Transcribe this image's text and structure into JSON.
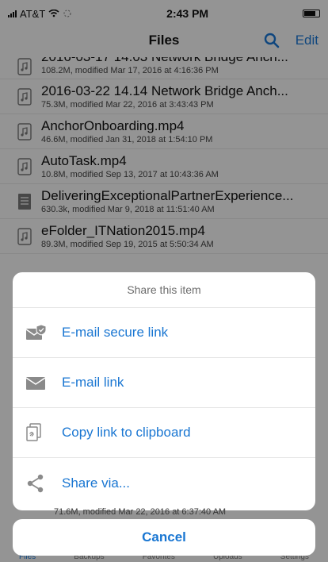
{
  "status_bar": {
    "carrier": "AT&T",
    "time": "2:43 PM"
  },
  "nav": {
    "title": "Files",
    "edit_label": "Edit",
    "search_icon": "search-icon"
  },
  "files": [
    {
      "name": "2016-03-17 14.03 Network Bridge Anch...",
      "meta": "108.2M, modified Mar 17, 2016 at 4:16:36 PM",
      "icon": "audio-file-icon"
    },
    {
      "name": "2016-03-22 14.14 Network Bridge Anch...",
      "meta": "75.3M, modified Mar 22, 2016 at 3:43:43 PM",
      "icon": "audio-file-icon"
    },
    {
      "name": "AnchorOnboarding.mp4",
      "meta": "46.6M, modified Jan 31, 2018 at 1:54:10 PM",
      "icon": "audio-file-icon"
    },
    {
      "name": "AutoTask.mp4",
      "meta": "10.8M, modified Sep 13, 2017 at 10:43:36 AM",
      "icon": "audio-file-icon"
    },
    {
      "name": "DeliveringExceptionalPartnerExperience...",
      "meta": "630.3k, modified Mar 9, 2018 at 11:51:40 AM",
      "icon": "document-icon"
    },
    {
      "name": "eFolder_ITNation2015.mp4",
      "meta": "89.3M, modified Sep 19, 2015 at 5:50:34 AM",
      "icon": "audio-file-icon"
    }
  ],
  "share_sheet": {
    "title": "Share this item",
    "items": [
      {
        "label": "E-mail secure link",
        "icon": "secure-mail-icon"
      },
      {
        "label": "E-mail link",
        "icon": "mail-icon"
      },
      {
        "label": "Copy link to clipboard",
        "icon": "copy-link-icon"
      },
      {
        "label": "Share via...",
        "icon": "share-icon"
      }
    ]
  },
  "behind_meta": "71.6M, modified Mar 22, 2016 at 6:37:40 AM",
  "cancel_label": "Cancel",
  "tabbar": {
    "items": [
      "Files",
      "Backups",
      "Favorites",
      "Uploads",
      "Settings"
    ]
  },
  "colors": {
    "accent": "#1976d2",
    "dim_overlay": "rgba(0,0,0,0.40)",
    "sheet_bg": "#ffffff"
  }
}
